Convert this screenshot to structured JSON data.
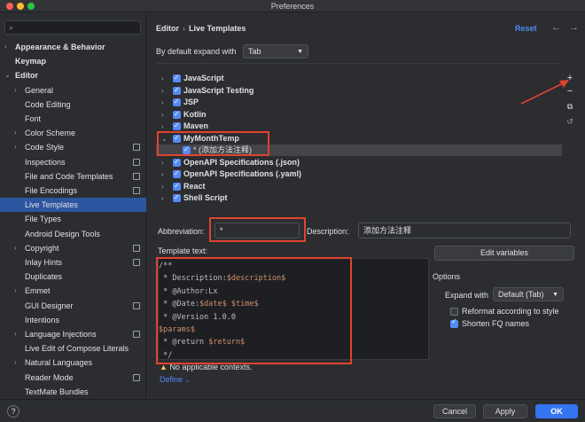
{
  "window": {
    "title": "Preferences"
  },
  "sidebar": {
    "search_placeholder": "",
    "items": [
      {
        "label": "Appearance & Behavior",
        "bold": true,
        "arrow": "›",
        "indent": 0
      },
      {
        "label": "Keymap",
        "bold": true,
        "arrow": "",
        "indent": 0
      },
      {
        "label": "Editor",
        "bold": true,
        "arrow": "⌄",
        "indent": 0
      },
      {
        "label": "General",
        "arrow": "›",
        "indent": 1
      },
      {
        "label": "Code Editing",
        "arrow": "",
        "indent": 1
      },
      {
        "label": "Font",
        "arrow": "",
        "indent": 1
      },
      {
        "label": "Color Scheme",
        "arrow": "›",
        "indent": 1
      },
      {
        "label": "Code Style",
        "arrow": "›",
        "indent": 1,
        "project": true
      },
      {
        "label": "Inspections",
        "arrow": "",
        "indent": 1,
        "project": true
      },
      {
        "label": "File and Code Templates",
        "arrow": "",
        "indent": 1,
        "project": true
      },
      {
        "label": "File Encodings",
        "arrow": "",
        "indent": 1,
        "project": true
      },
      {
        "label": "Live Templates",
        "arrow": "",
        "indent": 1,
        "selected": true
      },
      {
        "label": "File Types",
        "arrow": "",
        "indent": 1
      },
      {
        "label": "Android Design Tools",
        "arrow": "",
        "indent": 1
      },
      {
        "label": "Copyright",
        "arrow": "›",
        "indent": 1,
        "project": true
      },
      {
        "label": "Inlay Hints",
        "arrow": "",
        "indent": 1,
        "project": true
      },
      {
        "label": "Duplicates",
        "arrow": "",
        "indent": 1
      },
      {
        "label": "Emmet",
        "arrow": "›",
        "indent": 1
      },
      {
        "label": "GUI Designer",
        "arrow": "",
        "indent": 1,
        "project": true
      },
      {
        "label": "Intentions",
        "arrow": "",
        "indent": 1
      },
      {
        "label": "Language Injections",
        "arrow": "›",
        "indent": 1,
        "project": true
      },
      {
        "label": "Live Edit of Compose Literals",
        "arrow": "",
        "indent": 1
      },
      {
        "label": "Natural Languages",
        "arrow": "›",
        "indent": 1
      },
      {
        "label": "Reader Mode",
        "arrow": "",
        "indent": 1,
        "project": true
      },
      {
        "label": "TextMate Bundles",
        "arrow": "",
        "indent": 1
      }
    ]
  },
  "header": {
    "breadcrumb": [
      "Editor",
      "Live Templates"
    ],
    "breadcrumb_sep": "›",
    "reset_label": "Reset",
    "back_icon": "←",
    "forward_icon": "→"
  },
  "expand_default": {
    "label": "By default expand with",
    "value": "Tab"
  },
  "templates": {
    "groups": [
      {
        "name": "JavaScript",
        "arrow": "›",
        "checked": true
      },
      {
        "name": "JavaScript Testing",
        "arrow": "›",
        "checked": true
      },
      {
        "name": "JSP",
        "arrow": "›",
        "checked": true
      },
      {
        "name": "Kotlin",
        "arrow": "›",
        "checked": true
      },
      {
        "name": "Maven",
        "arrow": "›",
        "checked": true
      },
      {
        "name": "MyMonthTemp",
        "arrow": "⌄",
        "checked": true
      },
      {
        "name": "* (添加方法注释)",
        "arrow": "",
        "checked": true,
        "child": true,
        "selected": true
      },
      {
        "name": "OpenAPI Specifications (.json)",
        "arrow": "›",
        "checked": true
      },
      {
        "name": "OpenAPI Specifications (.yaml)",
        "arrow": "›",
        "checked": true
      },
      {
        "name": "React",
        "arrow": "›",
        "checked": true
      },
      {
        "name": "Shell Script",
        "arrow": "›",
        "checked": true
      }
    ]
  },
  "toolbar": {
    "add_icon": "+",
    "remove_icon": "−",
    "copy_icon": "⧉",
    "restore_icon": "↺"
  },
  "abbreviation": {
    "label": "Abbreviation:",
    "value": "*"
  },
  "description": {
    "label": "Description:",
    "value": "添加方法注释"
  },
  "template_text": {
    "label": "Template text:",
    "lines": [
      {
        "parts": [
          {
            "t": "/**",
            "v": false
          }
        ]
      },
      {
        "parts": [
          {
            "t": " * Description:",
            "v": false
          },
          {
            "t": "$description$",
            "v": true
          }
        ]
      },
      {
        "parts": [
          {
            "t": " * @Author:Lx",
            "v": false
          }
        ]
      },
      {
        "parts": [
          {
            "t": " * @Date:",
            "v": false
          },
          {
            "t": "$date$",
            "v": true
          },
          {
            "t": " ",
            "v": false
          },
          {
            "t": "$time$",
            "v": true
          }
        ]
      },
      {
        "parts": [
          {
            "t": " * @Version 1.0.0",
            "v": false
          }
        ]
      },
      {
        "parts": [
          {
            "t": "$params$",
            "v": true
          }
        ]
      },
      {
        "parts": [
          {
            "t": " * @return ",
            "v": false
          },
          {
            "t": "$return$",
            "v": true
          }
        ]
      },
      {
        "parts": [
          {
            "t": " */",
            "v": false
          }
        ]
      }
    ]
  },
  "edit_variables_label": "Edit variables",
  "options": {
    "label": "Options",
    "expand_with_label": "Expand with",
    "expand_with_value": "Default (Tab)",
    "reformat_label": "Reformat according to style",
    "reformat_checked": false,
    "shorten_label": "Shorten FQ names",
    "shorten_checked": true
  },
  "contexts": {
    "warning": "No applicable contexts.",
    "define_label": "Define"
  },
  "footer": {
    "help": "?",
    "cancel": "Cancel",
    "apply": "Apply",
    "ok": "OK"
  },
  "colors": {
    "accent": "#3574f0",
    "selection": "#2e55a0",
    "highlight": "#e0432f",
    "variable": "#cf8e6d"
  }
}
